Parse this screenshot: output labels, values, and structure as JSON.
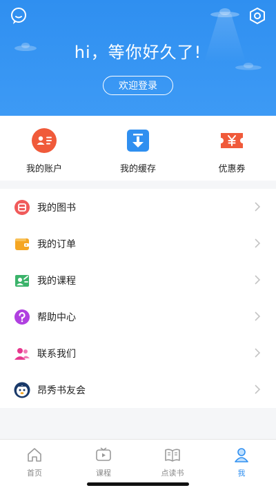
{
  "header": {
    "greeting": "hi，等你好久了!",
    "login_button": "欢迎登录",
    "chat_icon": "chat-bubble-icon",
    "settings_icon": "hexagon-settings-icon",
    "background_color": "#2f8ff0"
  },
  "quick_actions": [
    {
      "label": "我的账户",
      "icon": "account-card-icon",
      "color": "#f05a3a"
    },
    {
      "label": "我的缓存",
      "icon": "download-icon",
      "color": "#2f8ff0"
    },
    {
      "label": "优惠券",
      "icon": "coupon-icon",
      "color": "#f05a3a"
    }
  ],
  "menu": [
    {
      "label": "我的图书",
      "icon": "book-icon",
      "color": "#f05a5a"
    },
    {
      "label": "我的订单",
      "icon": "wallet-icon",
      "color": "#f5a623"
    },
    {
      "label": "我的课程",
      "icon": "course-icon",
      "color": "#3bb36a"
    },
    {
      "label": "帮助中心",
      "icon": "help-icon",
      "color": "#b040e0"
    },
    {
      "label": "联系我们",
      "icon": "contact-icon",
      "color": "#e6388e"
    },
    {
      "label": "昂秀书友会",
      "icon": "club-avatar-icon",
      "color": "#1a3a6a"
    }
  ],
  "tabbar": [
    {
      "label": "首页",
      "icon": "home-icon",
      "active": false
    },
    {
      "label": "课程",
      "icon": "video-icon",
      "active": false
    },
    {
      "label": "点读书",
      "icon": "open-book-icon",
      "active": false
    },
    {
      "label": "我",
      "icon": "user-icon",
      "active": true
    }
  ],
  "colors": {
    "accent": "#2f8ff0",
    "inactive": "#888888"
  }
}
